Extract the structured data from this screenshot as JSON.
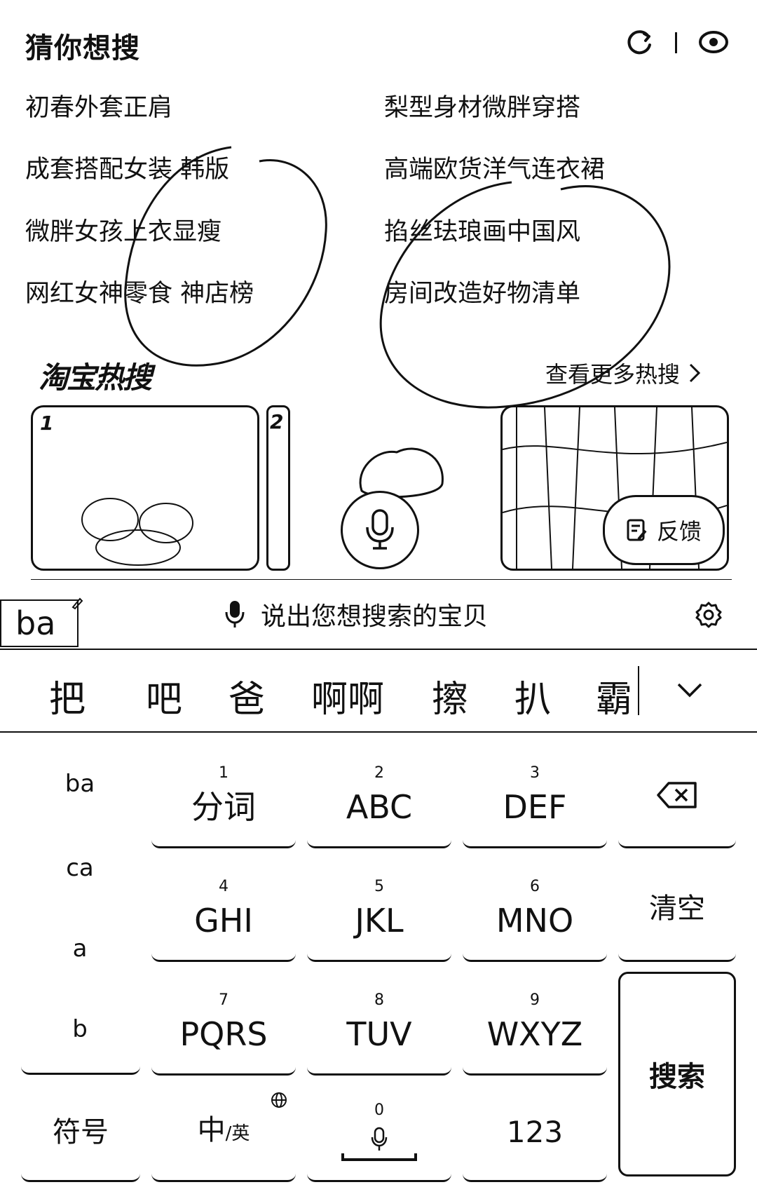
{
  "guess": {
    "title": "猜你想搜",
    "keywords": [
      "初春外套正肩",
      "梨型身材微胖穿搭",
      "成套搭配女装 韩版",
      "高端欧货洋气连衣裙",
      "微胖女孩上衣显瘦",
      "掐丝珐琅画中国风",
      "网红女神零食 神店榜",
      "房间改造好物清单"
    ]
  },
  "hot": {
    "title": "淘宝热搜",
    "more_label": "查看更多热搜",
    "ranks": [
      "1",
      "2"
    ],
    "feedback_label": "反馈"
  },
  "input": {
    "composing": "ba",
    "voice_hint": "说出您想搜索的宝贝"
  },
  "candidates": [
    "把",
    "吧",
    "爸",
    "啊啊",
    "擦",
    "扒",
    "霸"
  ],
  "keyboard": {
    "side_list": [
      "ba",
      "ca",
      "a",
      "b"
    ],
    "keys": [
      {
        "num": "1",
        "label": "分词"
      },
      {
        "num": "2",
        "label": "ABC"
      },
      {
        "num": "3",
        "label": "DEF"
      },
      {
        "num": "4",
        "label": "GHI"
      },
      {
        "num": "5",
        "label": "JKL"
      },
      {
        "num": "6",
        "label": "MNO"
      },
      {
        "num": "7",
        "label": "PQRS"
      },
      {
        "num": "8",
        "label": "TUV"
      },
      {
        "num": "9",
        "label": "WXYZ"
      }
    ],
    "clear_label": "清空",
    "symbol_label": "符号",
    "lang_main": "中",
    "lang_sub": "/英",
    "space_num": "0",
    "num_label": "123",
    "enter_label": "搜索"
  },
  "icons": [
    "refresh-icon",
    "eye-icon",
    "chevron-right-icon",
    "mic-icon",
    "feedback-icon",
    "gear-icon",
    "chevron-down-icon",
    "backspace-icon",
    "globe-icon"
  ]
}
